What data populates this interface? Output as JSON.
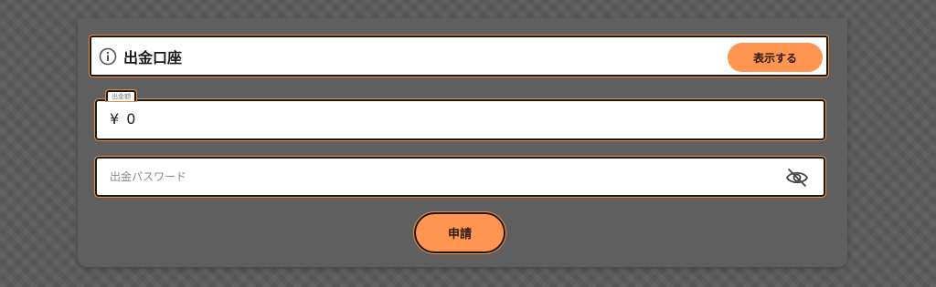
{
  "account": {
    "icon": "info-icon",
    "title": "出金口座",
    "show_button_label": "表示する"
  },
  "amount": {
    "legend": "出金額",
    "currency_symbol": "¥",
    "value": "0"
  },
  "password": {
    "placeholder": "出金パスワード",
    "toggle_icon": "eye-off-icon"
  },
  "apply_button_label": "申請",
  "colors": {
    "accent": "#ff9550",
    "accent_border": "#f08a3a",
    "background": "#5b5b5b",
    "text": "#1a1a1a"
  }
}
